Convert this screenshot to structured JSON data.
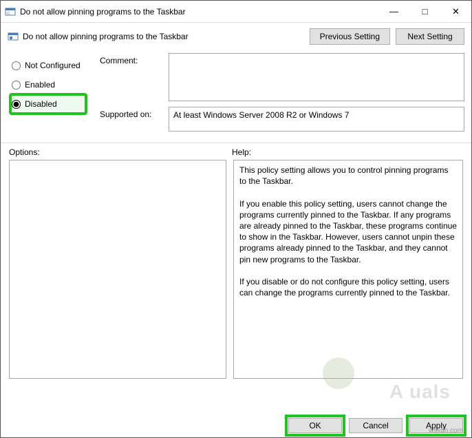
{
  "titlebar": {
    "title": "Do not allow pinning programs to the Taskbar"
  },
  "header": {
    "title": "Do not allow pinning programs to the Taskbar",
    "prev": "Previous Setting",
    "next": "Next Setting"
  },
  "radios": {
    "not_configured": "Not Configured",
    "enabled": "Enabled",
    "disabled": "Disabled",
    "selected": "disabled"
  },
  "fields": {
    "comment_label": "Comment:",
    "comment_value": "",
    "supported_label": "Supported on:",
    "supported_value": "At least Windows Server 2008 R2 or Windows 7"
  },
  "sections": {
    "options_label": "Options:",
    "help_label": "Help:",
    "help_text": "This policy setting allows you to control pinning programs to the Taskbar.\n\nIf you enable this policy setting, users cannot change the programs currently pinned to the Taskbar. If any programs are already pinned to the Taskbar, these programs continue to show in the Taskbar. However, users cannot unpin these programs already pinned to the Taskbar, and they cannot pin new programs to the Taskbar.\n\nIf you disable or do not configure this policy setting, users can change the programs currently pinned to the Taskbar."
  },
  "footer": {
    "ok": "OK",
    "cancel": "Cancel",
    "apply": "Apply"
  },
  "watermark": "A   uals",
  "credit": "wsxdn.com"
}
